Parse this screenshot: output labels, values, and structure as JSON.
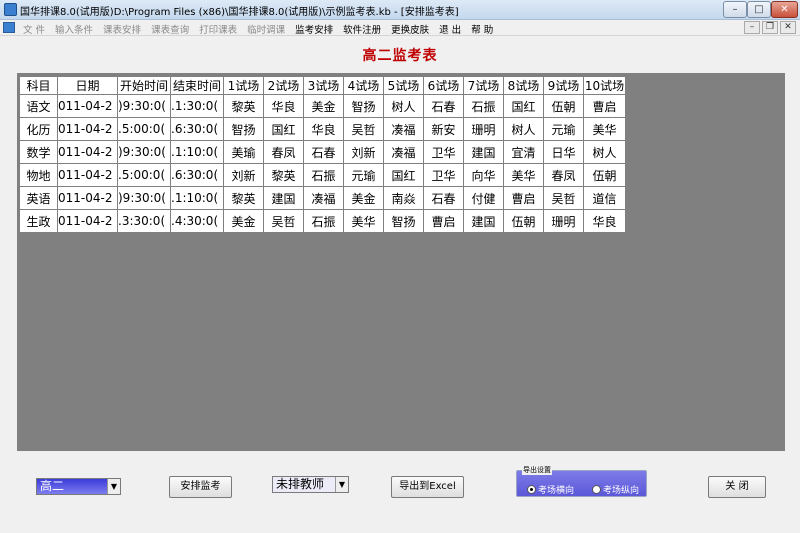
{
  "window": {
    "title": "国华排课8.0(试用版)D:\\Program Files (x86)\\国华排课8.0(试用版)\\示例监考表.kb - [安排监考表]",
    "controls": {
      "minimize": "–",
      "maximize": "□",
      "close": "✕"
    }
  },
  "menu": {
    "items": [
      {
        "label": "文 件",
        "enabled": false
      },
      {
        "label": "输入条件",
        "enabled": false
      },
      {
        "label": "课表安排",
        "enabled": false
      },
      {
        "label": "课表查询",
        "enabled": false
      },
      {
        "label": "打印课表",
        "enabled": false
      },
      {
        "label": "临时调课",
        "enabled": false
      },
      {
        "label": "监考安排",
        "enabled": true
      },
      {
        "label": "软件注册",
        "enabled": true
      },
      {
        "label": "更换皮肤",
        "enabled": true
      },
      {
        "label": "退 出",
        "enabled": true
      },
      {
        "label": "帮 助",
        "enabled": true
      }
    ],
    "mdi_controls": {
      "minimize": "–",
      "restore": "❐",
      "close": "✕"
    }
  },
  "page": {
    "title": "高二监考表"
  },
  "table": {
    "headers": [
      "科目",
      "日期",
      "开始时间",
      "结束时间",
      "1试场",
      "2试场",
      "3试场",
      "4试场",
      "5试场",
      "6试场",
      "7试场",
      "8试场",
      "9试场",
      "10试场"
    ],
    "rows": [
      [
        "语文",
        "011-04-2",
        ")9:30:0(",
        ".1:30:0(",
        "黎英",
        "华良",
        "美金",
        "智扬",
        "树人",
        "石春",
        "石振",
        "国红",
        "伍朝",
        "曹启"
      ],
      [
        "化历",
        "011-04-2",
        ".5:00:0(",
        ".6:30:0(",
        "智扬",
        "国红",
        "华良",
        "吴哲",
        "凑福",
        "新安",
        "珊明",
        "树人",
        "元瑜",
        "美华"
      ],
      [
        "数学",
        "011-04-2",
        ")9:30:0(",
        ".1:10:0(",
        "美瑜",
        "春凤",
        "石春",
        "刘新",
        "凑福",
        "卫华",
        "建国",
        "宜清",
        "日华",
        "树人"
      ],
      [
        "物地",
        "011-04-2",
        ".5:00:0(",
        ".6:30:0(",
        "刘新",
        "黎英",
        "石振",
        "元瑜",
        "国红",
        "卫华",
        "向华",
        "美华",
        "春凤",
        "伍朝"
      ],
      [
        "英语",
        "011-04-2",
        ")9:30:0(",
        ".1:10:0(",
        "黎英",
        "建国",
        "凑福",
        "美金",
        "南焱",
        "石春",
        "付健",
        "曹启",
        "吴哲",
        "道信"
      ],
      [
        "生政",
        "011-04-2",
        ".3:30:0(",
        ".4:30:0(",
        "美金",
        "吴哲",
        "石振",
        "美华",
        "智扬",
        "曹启",
        "建国",
        "伍朝",
        "珊明",
        "华良"
      ]
    ]
  },
  "controls": {
    "grade_select": {
      "value": "高二"
    },
    "arrange_button": "安排监考",
    "teacher_select": {
      "value": "未排教师"
    },
    "export_button": "导出到Excel",
    "export_settings": {
      "legend": "导出设置",
      "options": [
        {
          "label": "考场横向",
          "checked": true
        },
        {
          "label": "考场纵向",
          "checked": false
        }
      ]
    },
    "close_button": "关 闭"
  },
  "colors": {
    "title_red": "#c00000",
    "grid_background": "#808080",
    "select_blue": "#4a48dc"
  }
}
